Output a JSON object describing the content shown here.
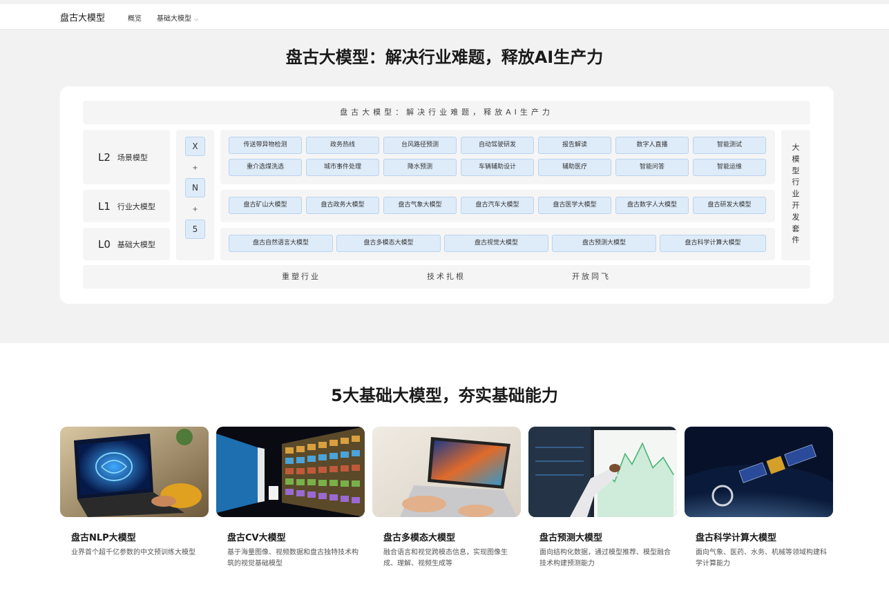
{
  "nav": {
    "brand": "盘古大模型",
    "items": [
      {
        "label": "概览"
      },
      {
        "label": "基础大模型"
      }
    ]
  },
  "hero": {
    "title": "盘古大模型：解决行业难题，释放AI生产力"
  },
  "architecture": {
    "header": "盘古大模型：解决行业难题，释放AI生产力",
    "levels": [
      {
        "code": "L2",
        "name": "场景模型"
      },
      {
        "code": "L1",
        "name": "行业大模型"
      },
      {
        "code": "L0",
        "name": "基础大模型"
      }
    ],
    "xn5": [
      "X",
      "+",
      "N",
      "+",
      "5"
    ],
    "l2_row1": [
      "传送带异物检测",
      "政务热线",
      "台风路径预测",
      "自动驾驶研发",
      "报告解读",
      "数字人直播",
      "智能测试"
    ],
    "l2_row2": [
      "重介选煤洗选",
      "城市事件处理",
      "降水预测",
      "车辆辅助设计",
      "辅助医疗",
      "智能问答",
      "智能运维"
    ],
    "l1": [
      "盘古矿山大模型",
      "盘古政务大模型",
      "盘古气象大模型",
      "盘古汽车大模型",
      "盘古医学大模型",
      "盘古数字人大模型",
      "盘古研发大模型"
    ],
    "l0": [
      "盘古自然语言大模型",
      "盘古多模态大模型",
      "盘古视觉大模型",
      "盘古预测大模型",
      "盘古科学计算大模型"
    ],
    "side_kit": [
      "大",
      "模",
      "型",
      "行",
      "业",
      "开",
      "发",
      "套",
      "件"
    ],
    "footer": [
      "重塑行业",
      "技术扎根",
      "开放同飞"
    ]
  },
  "section": {
    "title": "5大基础大模型，夯实基础能力"
  },
  "cards": [
    {
      "title": "盘古NLP大模型",
      "desc": "业界首个超千亿参数的中文预训练大模型",
      "icon": "laptop-brain-image"
    },
    {
      "title": "盘古CV大模型",
      "desc": "基于海量图像、视频数据和盘古独特技术构筑的视觉基础模型",
      "icon": "video-wall-image"
    },
    {
      "title": "盘古多模态大模型",
      "desc": "融合语言和视觉跨模态信息，实现图像生成、理解、视频生成等",
      "icon": "laptop-art-image"
    },
    {
      "title": "盘古预测大模型",
      "desc": "面向结构化数据，通过模型推荐、模型融合技术构建预测能力",
      "icon": "stock-chart-image"
    },
    {
      "title": "盘古科学计算大模型",
      "desc": "面向气象、医药、水务、机械等领域构建科学计算能力",
      "icon": "satellite-earth-image"
    }
  ],
  "colors": {
    "chip_bg": "#deebf9",
    "chip_border": "#b9d3ee",
    "panel_bg": "#f5f5f5",
    "hero_bg": "#f2f2f2"
  }
}
